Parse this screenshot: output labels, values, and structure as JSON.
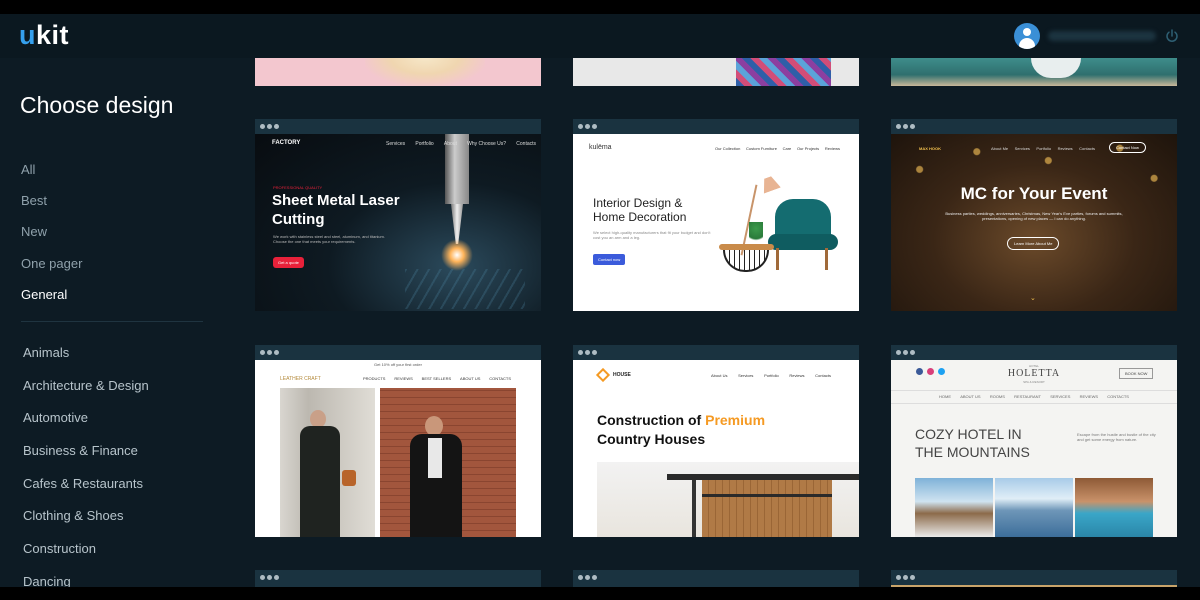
{
  "app": {
    "logo_u": "u",
    "logo_rest": "kit"
  },
  "sidebar": {
    "title": "Choose design",
    "filters": [
      "All",
      "Best",
      "New",
      "One pager",
      "General"
    ],
    "active_filter": "General",
    "categories": [
      "Animals",
      "Architecture & Design",
      "Automotive",
      "Business & Finance",
      "Cafes & Restaurants",
      "Clothing & Shoes",
      "Construction",
      "Dancing"
    ]
  },
  "templates": {
    "factory": {
      "brand": "FACTORY",
      "nav": [
        "Services",
        "Portfolio",
        "About",
        "Why Choose Us?",
        "Contacts"
      ],
      "tag": "PROFESSIONAL QUALITY",
      "heading1": "Sheet Metal Laser",
      "heading2": "Cutting",
      "text": "We work with stainless steel and steel, aluminum, and titanium. Choose the one that meets your requirements.",
      "button": "Get a quote"
    },
    "kulema": {
      "brand": "kulëma",
      "nav": [
        "Our Collection",
        "Custom Furniture",
        "Care",
        "Our Projects",
        "Reviews"
      ],
      "heading1": "Interior Design &",
      "heading2": "Home Decoration",
      "text": "We select high-quality manufacturers that fit your budget and don't cost you an arm and a leg.",
      "button": "Contact now"
    },
    "event": {
      "brand": "MAX HOOK",
      "nav": [
        "About Me",
        "Services",
        "Portfolio",
        "Reviews",
        "Contacts"
      ],
      "contact": "Contact Now",
      "heading": "MC for Your Event",
      "text": "Business parties, weddings, anniversaries, Christmas, New Year's Eve parties, forums and summits, presentations, opening of new places — I can do anything.",
      "button": "Learn More About Me"
    },
    "leather": {
      "topline": "Get 10% off your first order",
      "brand": "LEATHER CRAFT",
      "nav": [
        "PRODUCTS",
        "REVIEWS",
        "BEST SELLERS",
        "ABOUT US",
        "CONTACTS"
      ]
    },
    "house": {
      "brand": "HOUSE",
      "nav": [
        "About Us",
        "Services",
        "Portfolio",
        "Reviews",
        "Contacts"
      ],
      "heading1a": "Construction of ",
      "heading1b": "Premium",
      "heading2": "Country Houses"
    },
    "hotel": {
      "brand_small": "HOTEL",
      "brand": "HOLETTA",
      "brand_sub": "SPA & RESORT",
      "book": "BOOK NOW",
      "nav": [
        "HOME",
        "ABOUT US",
        "ROOMS",
        "RESTAURANT",
        "SERVICES",
        "REVIEWS",
        "CONTACTS"
      ],
      "heading1": "COZY HOTEL IN",
      "heading2": "THE MOUNTAINS",
      "text": "Escape from the hustle and bustle of the city and get some energy from nature."
    }
  },
  "colors": {
    "accent": "#35a0ee",
    "bg": "#0d1b24",
    "topbar": "#0b1820",
    "laser_red": "#e8213a",
    "premium_orange": "#f59a23",
    "kulema_button": "#3b5bdb"
  }
}
